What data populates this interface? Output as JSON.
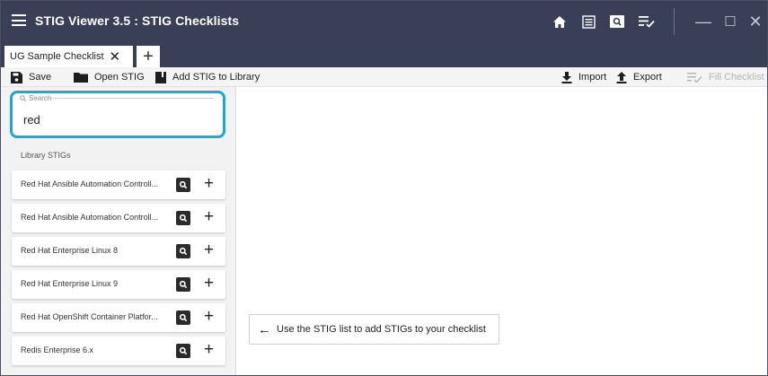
{
  "window": {
    "title": "STIG Viewer 3.5 : STIG Checklists",
    "icons": [
      "home-icon",
      "checklist-view-icon",
      "stig-view-icon",
      "checklist-manage-icon"
    ],
    "controls": {
      "minimize": "—",
      "maximize": "☐",
      "close": "✕"
    },
    "colors": {
      "titlebar": "#3a3f58",
      "accent": "#1aa6e0"
    }
  },
  "tabs": [
    {
      "label": "UG Sample Checklist",
      "close": "✕"
    }
  ],
  "tab_add": "+",
  "toolbar": {
    "save": "Save",
    "open_stig": "Open STIG",
    "add_to_library": "Add STIG to Library",
    "import": "Import",
    "export": "Export",
    "fill_checklist": "Fill Checklist"
  },
  "search": {
    "label": "Search",
    "value": "red"
  },
  "library": {
    "heading": "Library STIGs",
    "items": [
      {
        "name": "Red Hat Ansible Automation Controll...",
        "add": "+"
      },
      {
        "name": "Red Hat Ansible Automation Controll...",
        "add": "+"
      },
      {
        "name": "Red Hat Enterprise Linux 8",
        "add": "+"
      },
      {
        "name": "Red Hat Enterprise Linux 9",
        "add": "+"
      },
      {
        "name": "Red Hat OpenShift Container Platfor...",
        "add": "+"
      },
      {
        "name": "Redis Enterprise 6.x",
        "add": "+"
      }
    ]
  },
  "main": {
    "hint": "Use the STIG list to add STIGs to your checklist",
    "hint_arrow": "←"
  }
}
